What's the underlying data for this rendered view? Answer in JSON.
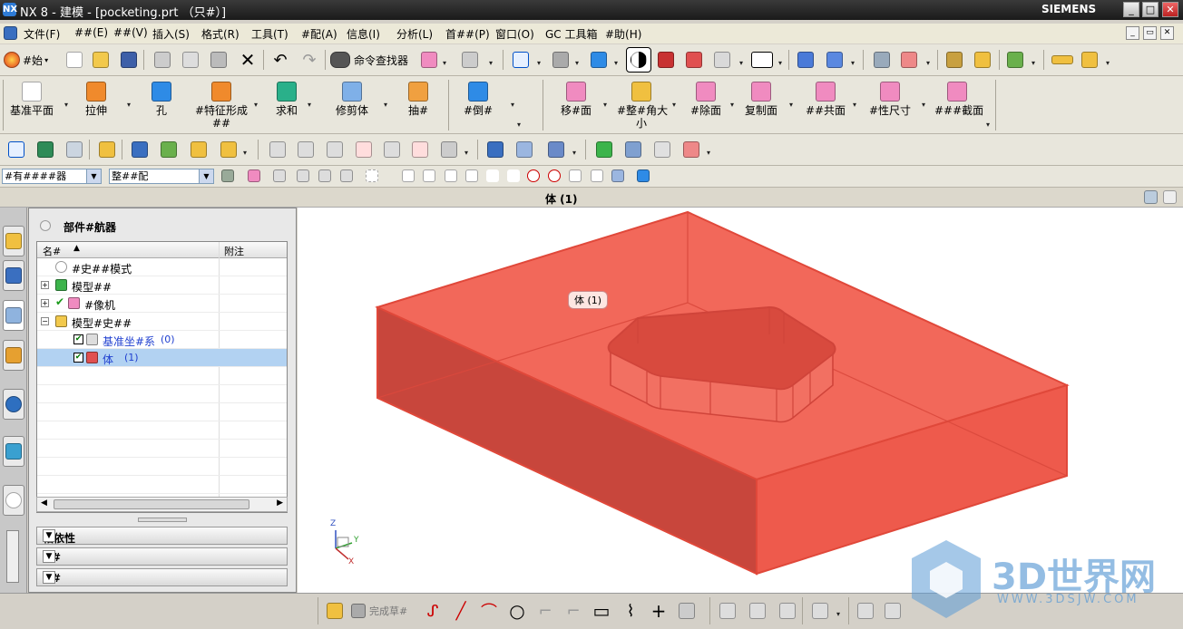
{
  "window": {
    "title": "NX 8 - 建模 - [pocketing.prt （只#）]",
    "brand": "SIEMENS",
    "app_icon": "NX",
    "buttons": [
      "_",
      "□",
      "✕"
    ]
  },
  "menu": {
    "items": [
      "文件(F)",
      "##(E)",
      "##(V)",
      "插入(S)",
      "格式(R)",
      "工具(T)",
      "#配(A)",
      "信息(I)",
      "分析(L)",
      "首##(P)",
      "窗口(O)",
      "GC 工具箱",
      "#助(H)"
    ],
    "mdi_buttons": [
      "_",
      "▭",
      "✕"
    ]
  },
  "toolbar1": {
    "start_label": "#始",
    "command_finder_label": "命令查找器"
  },
  "toolbar2": {
    "left": [
      {
        "label": "基准平面"
      },
      {
        "label": "拉伸"
      },
      {
        "label": "孔"
      },
      {
        "label": "#特征形成",
        "label2": "##"
      },
      {
        "label": "求和"
      },
      {
        "label": "修剪体"
      },
      {
        "label": "抽#"
      },
      {
        "label": "#倒#"
      }
    ],
    "right": [
      {
        "label": "移#面"
      },
      {
        "label": "#整#角大",
        "label2": "小"
      },
      {
        "label": "#除面"
      },
      {
        "label": "复制面"
      },
      {
        "label": "##共面"
      },
      {
        "label": "#性尺寸"
      },
      {
        "label": "###截面"
      }
    ]
  },
  "selection": {
    "filter": "#有####器",
    "scope": "整##配"
  },
  "graphics_title": "体 (1)",
  "navigator": {
    "title": "部件#航器",
    "columns": {
      "name": "名#",
      "comment": "附注"
    },
    "rows": [
      {
        "label": "#史##模式"
      },
      {
        "label": "模型##"
      },
      {
        "label": "#像机"
      },
      {
        "label": "模型#史##"
      },
      {
        "label": "基准坐#系",
        "detail": "(0)"
      },
      {
        "label": "体",
        "detail": "(1)"
      }
    ],
    "panels": [
      "相依性",
      "##",
      "##"
    ]
  },
  "viewport": {
    "tag": "体 (1)",
    "triad": {
      "z": "Z",
      "y": "Y",
      "x": "X"
    },
    "body_color": "#f0624f"
  },
  "bottom_toolbar": {
    "finish_sketch_label": "完成草#"
  },
  "watermark": {
    "text": "3D世界网",
    "url": "WWW.3DSJW.COM"
  }
}
